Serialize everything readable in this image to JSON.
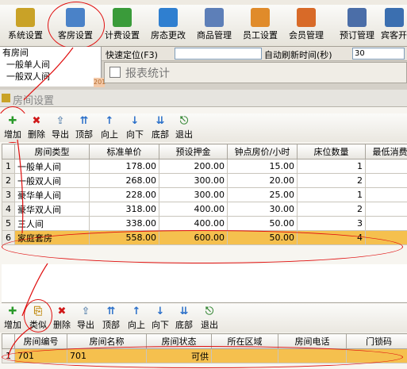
{
  "menu": [
    "系统设置",
    "客房设置",
    "计费设置",
    "房态更改",
    "商品管理",
    "员工设置",
    "会员管理",
    "预订管理",
    "宾客开"
  ],
  "toolbar": {
    "items": [
      {
        "label": "系统设置",
        "icon": "key-icon",
        "color": "#c9a227"
      },
      {
        "label": "客房设置",
        "icon": "room-settings-icon",
        "color": "#4a82c8"
      },
      {
        "label": "计费设置",
        "icon": "money-icon",
        "color": "#3a9b3a"
      },
      {
        "label": "房态更改",
        "icon": "house-upload-icon",
        "color": "#2f7fd0"
      },
      {
        "label": "商品管理",
        "icon": "box-icon",
        "color": "#5d7fb8"
      },
      {
        "label": "员工设置",
        "icon": "staff-icon",
        "color": "#e08b2a"
      },
      {
        "label": "会员管理",
        "icon": "member-icon",
        "color": "#d86a28"
      },
      {
        "label": "预订管理",
        "icon": "stapler-icon",
        "color": "#4b6ea8"
      },
      {
        "label": "宾客开",
        "icon": "guest-icon",
        "color": "#3b6fb0"
      }
    ]
  },
  "left_list": [
    "有房间",
    "一般单人间",
    "一般双人间"
  ],
  "quick_bar": {
    "quick_locate": "快速定位(F3)",
    "auto_refresh": "自动刷新时间(秒)",
    "refresh_value": "30",
    "year": "201"
  },
  "report_window": {
    "title": "报表统计"
  },
  "room_window": {
    "title": "房间设置"
  },
  "room_type_toolbar": [
    {
      "label": "增加",
      "icon": "add-icon",
      "glyph": "✚",
      "color": "#2a9a2a"
    },
    {
      "label": "删除",
      "icon": "delete-icon",
      "glyph": "✖",
      "color": "#d01818"
    },
    {
      "label": "导出",
      "icon": "export-icon",
      "glyph": "⇪",
      "color": "#6b8fb5"
    },
    {
      "label": "顶部",
      "icon": "move-top-icon",
      "glyph": "⇈",
      "color": "#2a6fc9"
    },
    {
      "label": "向上",
      "icon": "move-up-icon",
      "glyph": "↑",
      "color": "#2a6fc9"
    },
    {
      "label": "向下",
      "icon": "move-down-icon",
      "glyph": "↓",
      "color": "#2a6fc9"
    },
    {
      "label": "底部",
      "icon": "move-bottom-icon",
      "glyph": "⇊",
      "color": "#2a6fc9"
    },
    {
      "label": "退出",
      "icon": "exit-icon",
      "glyph": "⎋",
      "color": "#3a8a3a"
    }
  ],
  "room_types": {
    "columns": [
      "房间类型",
      "标准单价",
      "预设押金",
      "钟点房价/小时",
      "床位数量",
      "最低消费"
    ],
    "rows": [
      {
        "n": "1",
        "type": "一般单人间",
        "price": "178.00",
        "deposit": "200.00",
        "hourly": "15.00",
        "beds": "1"
      },
      {
        "n": "2",
        "type": "一般双人间",
        "price": "268.00",
        "deposit": "300.00",
        "hourly": "20.00",
        "beds": "2"
      },
      {
        "n": "3",
        "type": "豪华单人间",
        "price": "228.00",
        "deposit": "300.00",
        "hourly": "25.00",
        "beds": "1"
      },
      {
        "n": "4",
        "type": "豪华双人间",
        "price": "318.00",
        "deposit": "400.00",
        "hourly": "30.00",
        "beds": "2"
      },
      {
        "n": "5",
        "type": "三人间",
        "price": "338.00",
        "deposit": "400.00",
        "hourly": "50.00",
        "beds": "3"
      },
      {
        "n": "6",
        "type": "家庭套房",
        "price": "558.00",
        "deposit": "600.00",
        "hourly": "50.00",
        "beds": "4"
      }
    ]
  },
  "room_toolbar": [
    {
      "label": "增加",
      "icon": "add-icon",
      "glyph": "✚",
      "color": "#2a9a2a"
    },
    {
      "label": "类似",
      "icon": "copy-similar-icon",
      "glyph": "⎘",
      "color": "#c08a10"
    },
    {
      "label": "删除",
      "icon": "delete-icon",
      "glyph": "✖",
      "color": "#d01818"
    },
    {
      "label": "导出",
      "icon": "export-icon",
      "glyph": "⇪",
      "color": "#6b8fb5"
    },
    {
      "label": "顶部",
      "icon": "move-top-icon",
      "glyph": "⇈",
      "color": "#2a6fc9"
    },
    {
      "label": "向上",
      "icon": "move-up-icon",
      "glyph": "↑",
      "color": "#2a6fc9"
    },
    {
      "label": "向下",
      "icon": "move-down-icon",
      "glyph": "↓",
      "color": "#2a6fc9"
    },
    {
      "label": "底部",
      "icon": "move-bottom-icon",
      "glyph": "⇊",
      "color": "#2a6fc9"
    },
    {
      "label": "退出",
      "icon": "exit-icon",
      "glyph": "⎋",
      "color": "#3a8a3a"
    }
  ],
  "rooms": {
    "columns": [
      "房间编号",
      "房间名称",
      "房间状态",
      "所在区域",
      "房间电话",
      "门锁码"
    ],
    "rows": [
      {
        "n": "1",
        "id": "701",
        "name": "701",
        "status": "可供",
        "area": "",
        "phone": "",
        "lock": ""
      }
    ]
  },
  "colors": {
    "selected_row": "#f5c04e",
    "annotation": "#e01010"
  }
}
